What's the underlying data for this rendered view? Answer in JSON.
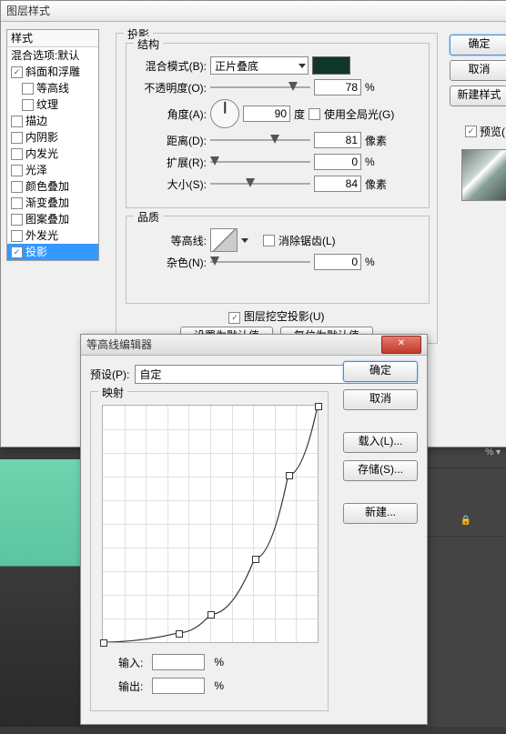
{
  "main": {
    "title": "图层样式",
    "styles_header": "样式",
    "blend_opts": "混合选项:默认",
    "items": [
      {
        "label": "斜面和浮雕",
        "checked": true,
        "indent": false
      },
      {
        "label": "等高线",
        "checked": false,
        "indent": true
      },
      {
        "label": "纹理",
        "checked": false,
        "indent": true
      },
      {
        "label": "描边",
        "checked": false,
        "indent": false
      },
      {
        "label": "内阴影",
        "checked": false,
        "indent": false
      },
      {
        "label": "内发光",
        "checked": false,
        "indent": false
      },
      {
        "label": "光泽",
        "checked": false,
        "indent": false
      },
      {
        "label": "颜色叠加",
        "checked": false,
        "indent": false
      },
      {
        "label": "渐变叠加",
        "checked": false,
        "indent": false
      },
      {
        "label": "图案叠加",
        "checked": false,
        "indent": false
      },
      {
        "label": "外发光",
        "checked": false,
        "indent": false
      },
      {
        "label": "投影",
        "checked": true,
        "indent": false,
        "selected": true
      }
    ],
    "buttons": {
      "ok": "确定",
      "cancel": "取消",
      "new_style": "新建样式",
      "preview": "预览("
    },
    "section_title": "投影",
    "structure": {
      "group": "结构",
      "blend_mode": {
        "label": "混合模式(B):",
        "value": "正片叠底"
      },
      "opacity": {
        "label": "不透明度(O):",
        "value": "78",
        "thumb": 78,
        "unit": "%"
      },
      "angle": {
        "label": "角度(A):",
        "value": "90",
        "unit": "度",
        "global": "使用全局光(G)"
      },
      "distance": {
        "label": "距离(D):",
        "value": "81",
        "thumb": 60,
        "unit": "像素"
      },
      "spread": {
        "label": "扩展(R):",
        "value": "0",
        "thumb": 0,
        "unit": "%"
      },
      "size": {
        "label": "大小(S):",
        "value": "84",
        "thumb": 35,
        "unit": "像素"
      }
    },
    "quality": {
      "group": "品质",
      "contour": {
        "label": "等高线:",
        "anti": "消除锯齿(L)"
      },
      "noise": {
        "label": "杂色(N):",
        "value": "0",
        "thumb": 0,
        "unit": "%"
      }
    },
    "knockout": "图层挖空投影(U)",
    "bottom": {
      "set_default": "设置为默认值",
      "reset_default": "复位为默认值"
    }
  },
  "editor": {
    "title": "等高线编辑器",
    "preset": {
      "label": "预设(P):",
      "value": "自定"
    },
    "mapping": "映射",
    "input": {
      "label": "输入:",
      "value": "",
      "unit": "%"
    },
    "output": {
      "label": "输出:",
      "value": "",
      "unit": "%"
    },
    "buttons": {
      "ok": "确定",
      "cancel": "取消",
      "load": "载入(L)...",
      "save": "存储(S)...",
      "new": "新建..."
    }
  },
  "chart_data": {
    "type": "line",
    "title": "映射",
    "xlabel": "输入",
    "ylabel": "输出",
    "xlim": [
      0,
      255
    ],
    "ylim": [
      0,
      255
    ],
    "x": [
      0,
      90,
      128,
      180,
      220,
      255
    ],
    "values": [
      0,
      10,
      30,
      90,
      180,
      255
    ]
  },
  "bg": {
    "pct": "%"
  }
}
